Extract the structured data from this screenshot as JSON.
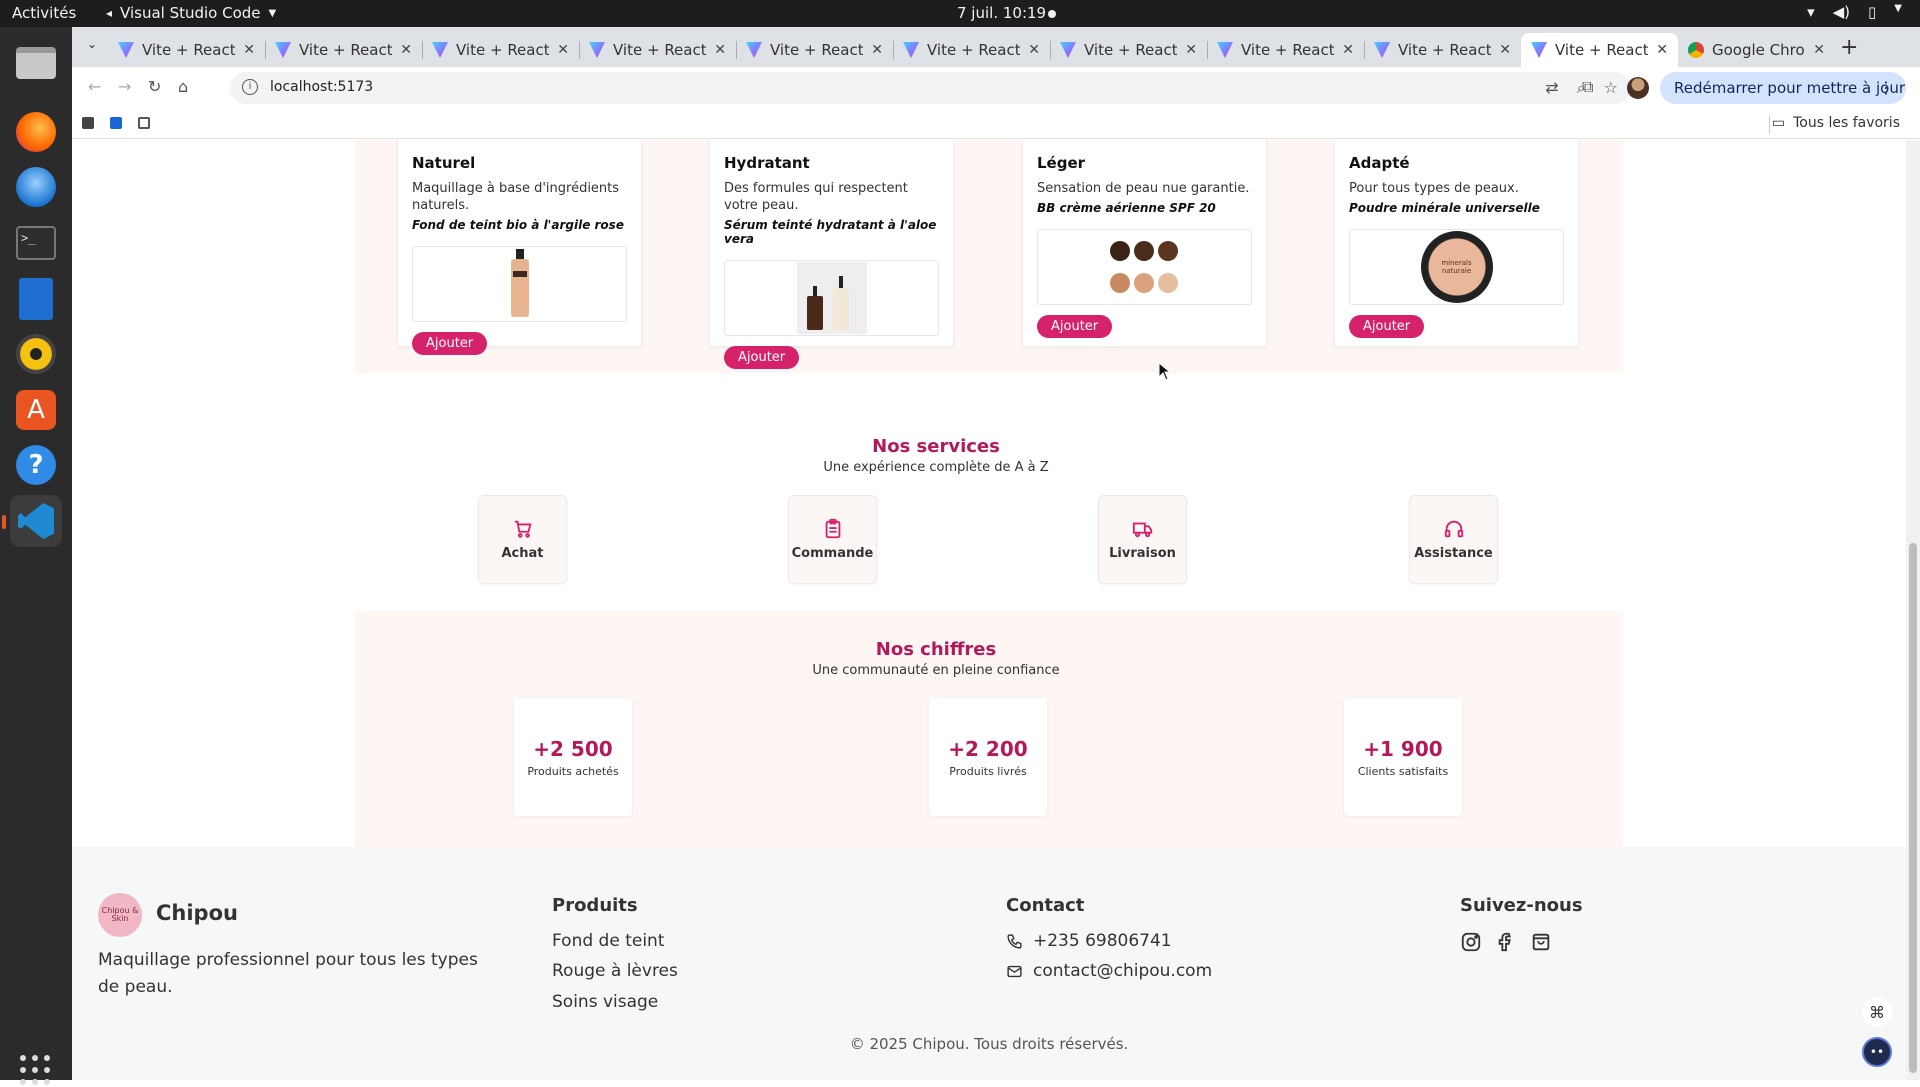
{
  "system": {
    "activities": "Activités",
    "app_name": "Visual Studio Code",
    "clock": "7 juil.  10:19"
  },
  "browser": {
    "tabs": [
      {
        "title": "Vite + React"
      },
      {
        "title": "Vite + React"
      },
      {
        "title": "Vite + React"
      },
      {
        "title": "Vite + React"
      },
      {
        "title": "Vite + React"
      },
      {
        "title": "Vite + React"
      },
      {
        "title": "Vite + React"
      },
      {
        "title": "Vite + React"
      },
      {
        "title": "Vite + React"
      },
      {
        "title": "Vite + React"
      },
      {
        "title": "Google Chrome"
      }
    ],
    "url": "localhost:5173",
    "update_button": "Redémarrer pour mettre à jour",
    "all_bookmarks": "Tous les favoris"
  },
  "products": [
    {
      "name": "Naturel",
      "desc": "Maquillage à base d'ingrédients naturels.",
      "sub": "Fond de teint bio à l'argile rose",
      "button": "Ajouter"
    },
    {
      "name": "Hydratant",
      "desc": "Des formules qui respectent votre peau.",
      "sub": "Sérum teinté hydratant à l'aloe vera",
      "button": "Ajouter"
    },
    {
      "name": "Léger",
      "desc": "Sensation de peau nue garantie.",
      "sub": "BB crème aérienne SPF 20",
      "button": "Ajouter"
    },
    {
      "name": "Adapté",
      "desc": "Pour tous types de peaux.",
      "sub": "Poudre minérale universelle",
      "button": "Ajouter",
      "image_text": "minerals naturale"
    }
  ],
  "services": {
    "title": "Nos services",
    "subtitle": "Une expérience complète de A à Z",
    "items": [
      {
        "label": "Achat",
        "icon": "cart-icon"
      },
      {
        "label": "Commande",
        "icon": "clipboard-icon"
      },
      {
        "label": "Livraison",
        "icon": "truck-icon"
      },
      {
        "label": "Assistance",
        "icon": "headset-icon"
      }
    ]
  },
  "stats": {
    "title": "Nos chiffres",
    "subtitle": "Une communauté en pleine confiance",
    "items": [
      {
        "value": "+2 500",
        "label": "Produits achetés"
      },
      {
        "value": "+2 200",
        "label": "Produits livrés"
      },
      {
        "value": "+1 900",
        "label": "Clients satisfaits"
      }
    ]
  },
  "footer": {
    "logo_text": "Chipou & Skin",
    "brand": "Chipou",
    "tagline": "Maquillage professionnel pour tous les types de peau.",
    "products_title": "Produits",
    "products_links": [
      "Fond de teint",
      "Rouge à lèvres",
      "Soins visage"
    ],
    "contact_title": "Contact",
    "phone": "+235 69806741",
    "email": "contact@chipou.com",
    "follow_title": "Suivez-nous",
    "copyright": "© 2025 Chipou. Tous droits réservés."
  },
  "colors": {
    "accent": "#d6226a",
    "accent_dark": "#b4195a",
    "band_bg": "#fdf6f3"
  }
}
